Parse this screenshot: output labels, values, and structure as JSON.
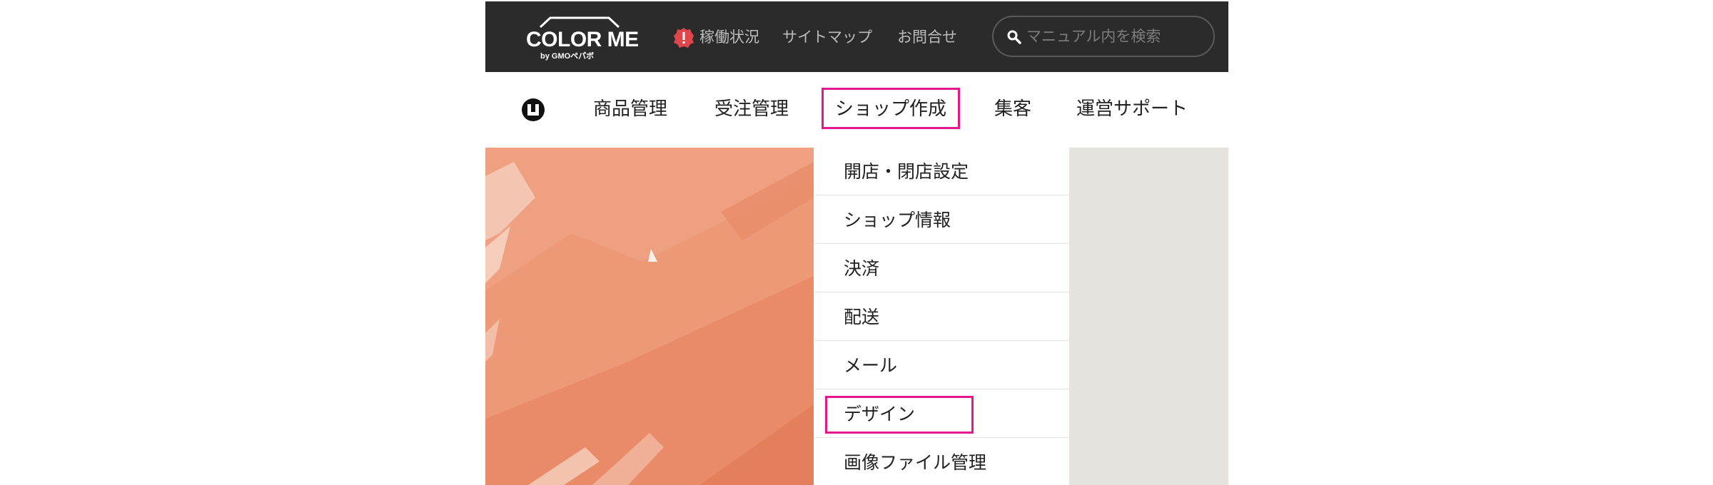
{
  "header": {
    "logo": {
      "main": "COLOR ME",
      "sub": "by GMOペパボ",
      "icon": "house-roof-icon"
    },
    "links": [
      {
        "label": "稼働状況",
        "icon": "alert-badge-icon",
        "icon_color": "#e0474c"
      },
      {
        "label": "サイトマップ"
      },
      {
        "label": "お問合せ"
      }
    ],
    "search": {
      "placeholder": "マニュアル内を検索",
      "value": "",
      "icon": "search-icon"
    }
  },
  "nav": {
    "home_icon": "help-manual-icon",
    "items": [
      {
        "label": "商品管理"
      },
      {
        "label": "受注管理"
      },
      {
        "label": "ショップ作成",
        "active": true
      },
      {
        "label": "集客"
      },
      {
        "label": "運営サポート"
      }
    ]
  },
  "dropdown": {
    "items": [
      {
        "label": "開店・閉店設定"
      },
      {
        "label": "ショップ情報"
      },
      {
        "label": "決済"
      },
      {
        "label": "配送"
      },
      {
        "label": "メール"
      },
      {
        "label": "デザイン",
        "highlighted": true
      },
      {
        "label": "画像ファイル管理"
      }
    ]
  },
  "colors": {
    "header_bg": "#2b2b2b",
    "highlight": "#e4188c",
    "hero_orange": "#ee9a7c",
    "panel_gray": "#e4e3dd"
  }
}
